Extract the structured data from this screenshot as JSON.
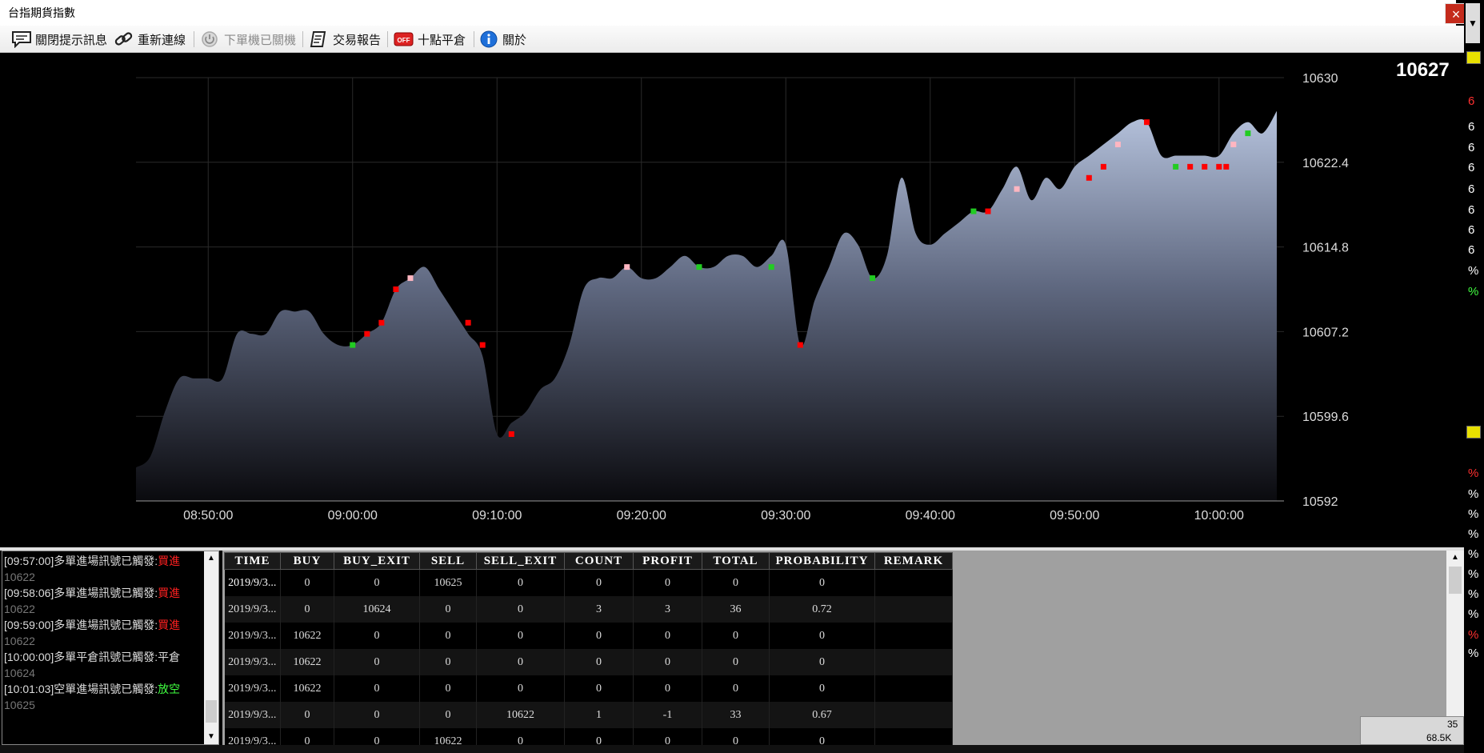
{
  "window": {
    "title": "台指期貨指數",
    "close_glyph": "×"
  },
  "toolbar": {
    "close_notice": "關閉提示訊息",
    "reconnect": "重新連線",
    "order_status": "下單機已關機",
    "trade_report": "交易報告",
    "close_position": "十點平倉",
    "off_badge": "OFF",
    "about": "關於"
  },
  "price_label": "10627",
  "chart_data": {
    "type": "area",
    "x_ticks": [
      "08:50:00",
      "09:00:00",
      "09:10:00",
      "09:20:00",
      "09:30:00",
      "09:40:00",
      "09:50:00",
      "10:00:00"
    ],
    "y_ticks": [
      "10630",
      "10622.4",
      "10614.8",
      "10607.2",
      "10599.6",
      "10592"
    ],
    "ylim": [
      10592,
      10630
    ],
    "xlim": [
      "08:45:00",
      "10:04:30"
    ],
    "x": [
      "08:45:00",
      "08:46:00",
      "08:47:00",
      "08:48:00",
      "08:49:00",
      "08:50:00",
      "08:51:00",
      "08:52:00",
      "08:53:00",
      "08:54:00",
      "08:55:00",
      "08:56:00",
      "08:57:00",
      "08:58:00",
      "08:59:00",
      "09:00:00",
      "09:01:00",
      "09:02:00",
      "09:03:00",
      "09:04:00",
      "09:05:00",
      "09:06:00",
      "09:07:00",
      "09:08:00",
      "09:09:00",
      "09:10:00",
      "09:11:00",
      "09:12:00",
      "09:13:00",
      "09:14:00",
      "09:15:00",
      "09:16:00",
      "09:17:00",
      "09:18:00",
      "09:19:00",
      "09:20:00",
      "09:21:00",
      "09:22:00",
      "09:23:00",
      "09:24:00",
      "09:25:00",
      "09:26:00",
      "09:27:00",
      "09:28:00",
      "09:29:00",
      "09:30:00",
      "09:31:00",
      "09:32:00",
      "09:33:00",
      "09:34:00",
      "09:35:00",
      "09:36:00",
      "09:37:00",
      "09:38:00",
      "09:39:00",
      "09:40:00",
      "09:41:00",
      "09:42:00",
      "09:43:00",
      "09:44:00",
      "09:45:00",
      "09:46:00",
      "09:47:00",
      "09:48:00",
      "09:49:00",
      "09:50:00",
      "09:51:00",
      "09:52:00",
      "09:53:00",
      "09:54:00",
      "09:55:00",
      "09:56:00",
      "09:57:00",
      "09:58:00",
      "09:59:00",
      "10:00:00",
      "10:01:00",
      "10:02:00",
      "10:03:00",
      "10:04:00"
    ],
    "y": [
      10595,
      10596,
      10600,
      10603,
      10603,
      10603,
      10603,
      10607,
      10607,
      10607,
      10609,
      10609,
      10609,
      10607,
      10606,
      10606,
      10607,
      10608,
      10611,
      10612,
      10613,
      10611,
      10609,
      10607,
      10605,
      10598,
      10599,
      10600,
      10602,
      10603,
      10606,
      10611,
      10612,
      10612,
      10613,
      10612,
      10612,
      10613,
      10614,
      10613,
      10613,
      10614,
      10614,
      10613,
      10614,
      10615,
      10606,
      10610,
      10613,
      10616,
      10615,
      10612,
      10614,
      10621,
      10616,
      10615,
      10616,
      10617,
      10618,
      10618,
      10620,
      10622,
      10619,
      10621,
      10620,
      10622,
      10623,
      10624,
      10625,
      10626,
      10626,
      10623,
      10623,
      10623,
      10623,
      10623,
      10625,
      10626,
      10625,
      10627
    ],
    "markers": [
      {
        "x": "09:00:00",
        "y": 10606,
        "color": "#22cc22"
      },
      {
        "x": "09:01:00",
        "y": 10607,
        "color": "#ff0000"
      },
      {
        "x": "09:02:00",
        "y": 10608,
        "color": "#ff0000"
      },
      {
        "x": "09:03:00",
        "y": 10611,
        "color": "#ff0000"
      },
      {
        "x": "09:04:00",
        "y": 10612,
        "color": "#ffb6c1"
      },
      {
        "x": "09:08:00",
        "y": 10608,
        "color": "#ff0000"
      },
      {
        "x": "09:09:00",
        "y": 10606,
        "color": "#ff0000"
      },
      {
        "x": "09:11:00",
        "y": 10598,
        "color": "#ff0000"
      },
      {
        "x": "09:19:00",
        "y": 10613,
        "color": "#ffb6c1"
      },
      {
        "x": "09:24:00",
        "y": 10613,
        "color": "#22cc22"
      },
      {
        "x": "09:29:00",
        "y": 10613,
        "color": "#22cc22"
      },
      {
        "x": "09:31:00",
        "y": 10606,
        "color": "#ff0000"
      },
      {
        "x": "09:36:00",
        "y": 10612,
        "color": "#22cc22"
      },
      {
        "x": "09:43:00",
        "y": 10618,
        "color": "#22cc22"
      },
      {
        "x": "09:44:00",
        "y": 10618,
        "color": "#ff0000"
      },
      {
        "x": "09:46:00",
        "y": 10620,
        "color": "#ffb6c1"
      },
      {
        "x": "09:51:00",
        "y": 10621,
        "color": "#ff0000"
      },
      {
        "x": "09:52:00",
        "y": 10622,
        "color": "#ff0000"
      },
      {
        "x": "09:53:00",
        "y": 10624,
        "color": "#ffb6c1"
      },
      {
        "x": "09:55:00",
        "y": 10626,
        "color": "#ff0000"
      },
      {
        "x": "09:57:00",
        "y": 10622,
        "color": "#22cc22"
      },
      {
        "x": "09:58:00",
        "y": 10622,
        "color": "#ff0000"
      },
      {
        "x": "09:59:00",
        "y": 10622,
        "color": "#ff0000"
      },
      {
        "x": "10:00:00",
        "y": 10622,
        "color": "#ff0000"
      },
      {
        "x": "10:00:30",
        "y": 10622,
        "color": "#ff0000"
      },
      {
        "x": "10:01:00",
        "y": 10624,
        "color": "#ffb6c1"
      },
      {
        "x": "10:02:00",
        "y": 10625,
        "color": "#22cc22"
      }
    ]
  },
  "messages": [
    {
      "time": "[09:57:00]",
      "text": "多單進場訊號已觸發:",
      "action": "買進",
      "action_color": "#ff2020",
      "value": "10622"
    },
    {
      "time": "[09:58:06]",
      "text": "多單進場訊號已觸發:",
      "action": "買進",
      "action_color": "#ff2020",
      "value": "10622"
    },
    {
      "time": "[09:59:00]",
      "text": "多單進場訊號已觸發:",
      "action": "買進",
      "action_color": "#ff2020",
      "value": "10622"
    },
    {
      "time": "[10:00:00]",
      "text": "多單平倉訊號已觸發:",
      "action": "平倉",
      "action_color": "#dddddd",
      "value": "10624"
    },
    {
      "time": "[10:01:03]",
      "text": "空單進場訊號已觸發:",
      "action": "放空",
      "action_color": "#40ff40",
      "value": "10625"
    }
  ],
  "table": {
    "headers": [
      "TIME",
      "BUY",
      "BUY_EXIT",
      "SELL",
      "SELL_EXIT",
      "COUNT",
      "PROFIT",
      "TOTAL",
      "PROBABILITY",
      "REMARK"
    ],
    "rows": [
      [
        "2019/9/3...",
        "0",
        "0",
        "10625",
        "0",
        "0",
        "0",
        "0",
        "0",
        ""
      ],
      [
        "2019/9/3...",
        "0",
        "10624",
        "0",
        "0",
        "3",
        "3",
        "36",
        "0.72",
        ""
      ],
      [
        "2019/9/3...",
        "10622",
        "0",
        "0",
        "0",
        "0",
        "0",
        "0",
        "0",
        ""
      ],
      [
        "2019/9/3...",
        "10622",
        "0",
        "0",
        "0",
        "0",
        "0",
        "0",
        "0",
        ""
      ],
      [
        "2019/9/3...",
        "10622",
        "0",
        "0",
        "0",
        "0",
        "0",
        "0",
        "0",
        ""
      ],
      [
        "2019/9/3...",
        "0",
        "0",
        "0",
        "10622",
        "1",
        "-1",
        "33",
        "0.67",
        ""
      ],
      [
        "2019/9/3...",
        "0",
        "0",
        "10622",
        "0",
        "0",
        "0",
        "0",
        "0",
        ""
      ]
    ]
  },
  "side_glyphs": [
    "6",
    "6",
    "6",
    "6",
    "6",
    "6",
    "6",
    "6",
    "%",
    "%",
    "%",
    "%",
    "%",
    "%",
    "%",
    "%",
    "%",
    "%",
    "%",
    "%"
  ],
  "side_glyph_colors": [
    "#ff3030",
    "#ffffff",
    "#ffffff",
    "#ffffff",
    "#ffffff",
    "#ffffff",
    "#ffffff",
    "#ffffff",
    "#ffffff",
    "#40ff40",
    "#ff3030",
    "#ffffff",
    "#ffffff",
    "#ffffff",
    "#ffffff",
    "#ffffff",
    "#ffffff",
    "#ffffff",
    "#ff3030",
    "#ffffff"
  ],
  "widget": {
    "n1": "35",
    "n2": "68.5K"
  }
}
